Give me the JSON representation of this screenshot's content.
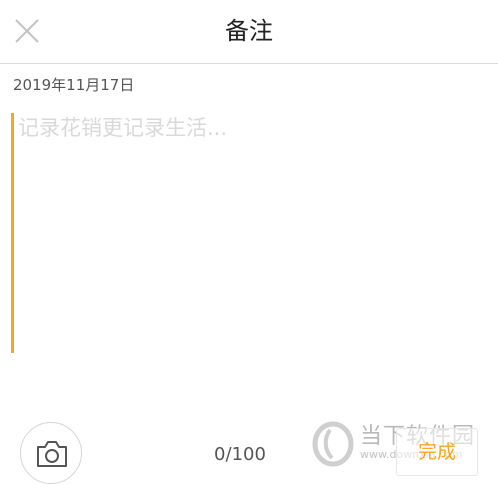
{
  "header": {
    "title": "备注",
    "close_icon": "close-icon"
  },
  "note": {
    "date": "2019年11月17日",
    "placeholder": "记录花销更记录生活..."
  },
  "footer": {
    "count": "0",
    "max": "100",
    "camera_icon": "camera-icon",
    "done_label": "完成"
  },
  "watermark": {
    "text": "当下软件园",
    "url": "www.downxia.com"
  },
  "colors": {
    "accent": "#f5a623",
    "placeholder": "#d9d9d9",
    "divider": "#dcdcdc"
  }
}
